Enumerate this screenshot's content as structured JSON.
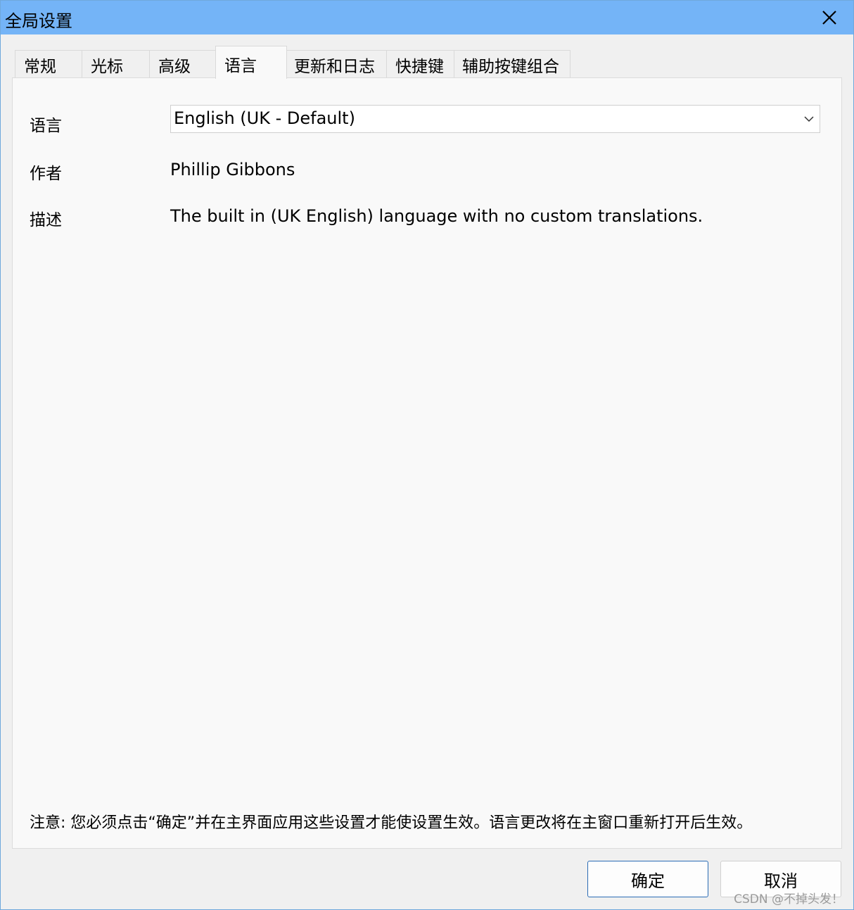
{
  "window": {
    "title": "全局设置",
    "colors": {
      "titlebar": "#74b4f7",
      "accent_border": "#2b6cb5",
      "panel": "#f9f9f9"
    }
  },
  "tabs": [
    {
      "label": "常规",
      "active": false
    },
    {
      "label": "光标",
      "active": false
    },
    {
      "label": "高级",
      "active": false
    },
    {
      "label": "语言",
      "active": true
    },
    {
      "label": "更新和日志",
      "active": false
    },
    {
      "label": "快捷键",
      "active": false
    },
    {
      "label": "辅助按键组合",
      "active": false
    }
  ],
  "language_panel": {
    "language_label": "语言",
    "language_value": "English (UK - Default)",
    "author_label": "作者",
    "author_value": "Phillip Gibbons",
    "description_label": "描述",
    "description_value": "The built in (UK English) language with no custom translations.",
    "note": "注意: 您必须点击“确定”并在主界面应用这些设置才能使设置生效。语言更改将在主窗口重新打开后生效。"
  },
  "buttons": {
    "ok": "确定",
    "cancel": "取消"
  },
  "watermark": "CSDN @不掉头发！",
  "icons": {
    "close": "close-icon",
    "dropdown": "chevron-down-icon"
  }
}
